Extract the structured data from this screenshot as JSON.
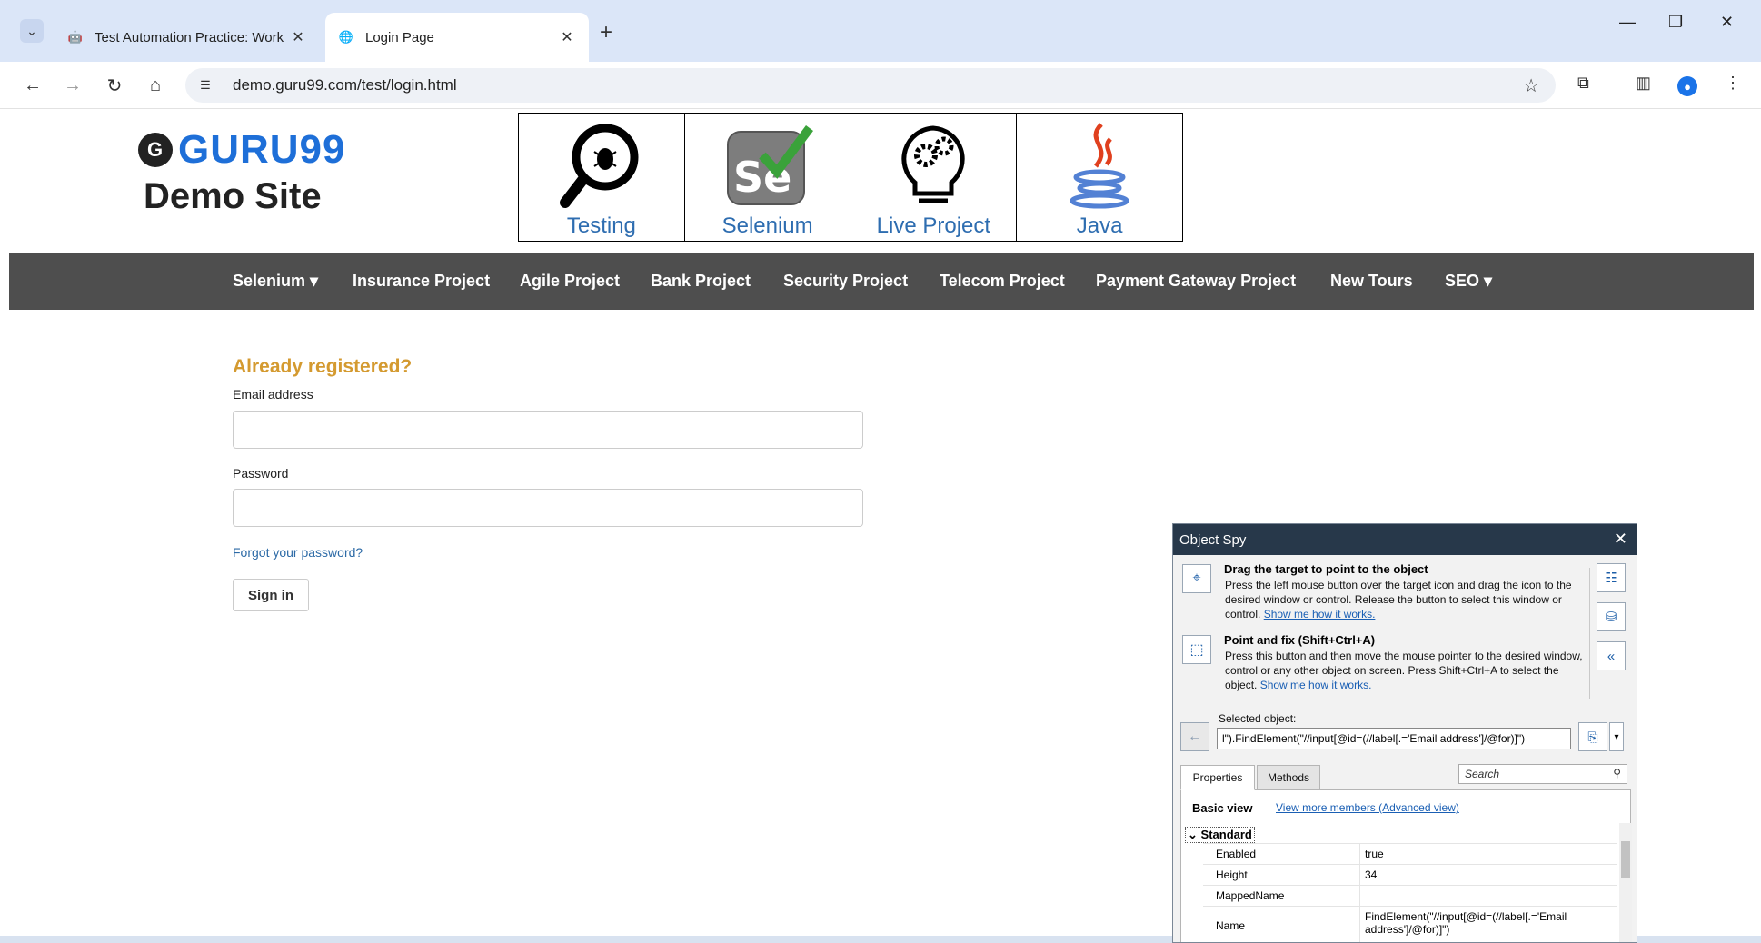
{
  "browser": {
    "tabs": [
      {
        "title": "Test Automation Practice: Work",
        "active": false
      },
      {
        "title": "Login Page",
        "active": true
      }
    ],
    "url": "demo.guru99.com/test/login.html"
  },
  "site": {
    "logo_brand": "GURU99",
    "logo_subtitle": "Demo Site",
    "banner": [
      {
        "label": "Testing",
        "icon": "magnifier-bug-icon"
      },
      {
        "label": "Selenium",
        "icon": "selenium-icon"
      },
      {
        "label": "Live Project",
        "icon": "lightbulb-gears-icon"
      },
      {
        "label": "Java",
        "icon": "java-icon"
      }
    ],
    "nav": [
      "Selenium ▾",
      "Insurance Project",
      "Agile Project",
      "Bank Project",
      "Security Project",
      "Telecom Project",
      "Payment Gateway Project",
      "New Tours",
      "SEO ▾"
    ]
  },
  "login": {
    "heading": "Already registered?",
    "email_label": "Email address",
    "email_value": "",
    "password_label": "Password",
    "password_value": "",
    "forgot": "Forgot your password?",
    "signin": "Sign in"
  },
  "spy": {
    "title": "Object Spy",
    "drag_title": "Drag the target to point to the object",
    "drag_text": "Press the left mouse button over the target icon and drag the icon to the desired window or control. Release the button to select this window or control.",
    "drag_link": "Show me how it works.",
    "point_title": "Point and fix (Shift+Ctrl+A)",
    "point_text": "Press this button and then move the mouse pointer to the desired window, control or any other object on screen. Press Shift+Ctrl+A to select the object.",
    "point_link": "Show me how it works.",
    "selected_label": "Selected object:",
    "selected_value": "l\").FindElement(\"//input[@id=(//label[.='Email address']/@for)]\")",
    "tab_properties": "Properties",
    "tab_methods": "Methods",
    "search_placeholder": "Search",
    "basic_view": "Basic view",
    "advanced_link": "View more members (Advanced view)",
    "group": "Standard",
    "properties": [
      {
        "name": "Enabled",
        "value": "true"
      },
      {
        "name": "Height",
        "value": "34"
      },
      {
        "name": "MappedName",
        "value": ""
      },
      {
        "name": "Name",
        "value": "FindElement(\"//input[@id=(//label[.='Email address']/@for)]\")"
      }
    ]
  },
  "colors": {
    "accent_heading": "#d49a30",
    "nav_bg": "#4e4e4e",
    "spy_titlebar": "#27384a",
    "link": "#2c6aa6"
  }
}
